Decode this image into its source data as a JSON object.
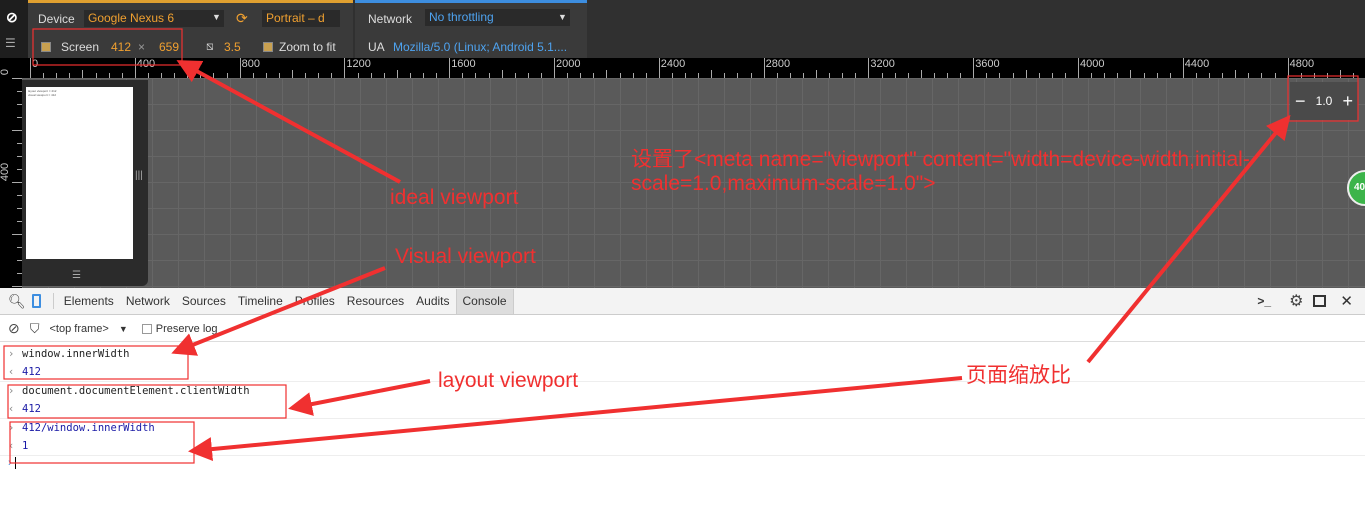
{
  "device": {
    "label": "Device",
    "model": "Google Nexus 6",
    "orientation": "Portrait – d",
    "screen_label": "Screen",
    "width": "412",
    "times": "×",
    "height": "659",
    "dpr": "3.5",
    "zoom_to_fit": "Zoom to fit"
  },
  "network": {
    "label": "Network",
    "throttling": "No throttling",
    "ua_label": "UA",
    "ua": "Mozilla/5.0 (Linux; Android 5.1...."
  },
  "ruler": {
    "h": [
      "0",
      "400",
      "800",
      "1200",
      "1600",
      "2000",
      "2400",
      "2800",
      "3200",
      "3600",
      "4000",
      "4400",
      "4800"
    ],
    "v": [
      "0",
      "400"
    ]
  },
  "screen_lines": [
    "layout viewport = 412",
    "visual viewport = 412"
  ],
  "zoom": {
    "minus": "−",
    "value": "1.0",
    "plus": "+"
  },
  "badge": "40",
  "tabs": [
    "Elements",
    "Network",
    "Sources",
    "Timeline",
    "Profiles",
    "Resources",
    "Audits",
    "Console"
  ],
  "active_tab": "Console",
  "filter": {
    "frame": "<top frame>",
    "preserve": "Preserve log"
  },
  "console": [
    {
      "input": "window.innerWidth",
      "output": "412"
    },
    {
      "input": "document.documentElement.clientWidth",
      "output": "412"
    },
    {
      "input": "412/window.innerWidth",
      "output": "1"
    }
  ],
  "annotations": {
    "ideal": "ideal viewport",
    "visual": "Visual viewport",
    "layout": "layout viewport",
    "scale": "页面缩放比",
    "meta1": "设置了<meta name=\"viewport\" content=\"width=device-width,initial-",
    "meta2": "scale=1.0,maximum-scale=1.0\">"
  },
  "colors": {
    "annotation": "#f03030",
    "device_accent": "#e0a030",
    "network_accent": "#3d8ee0"
  }
}
